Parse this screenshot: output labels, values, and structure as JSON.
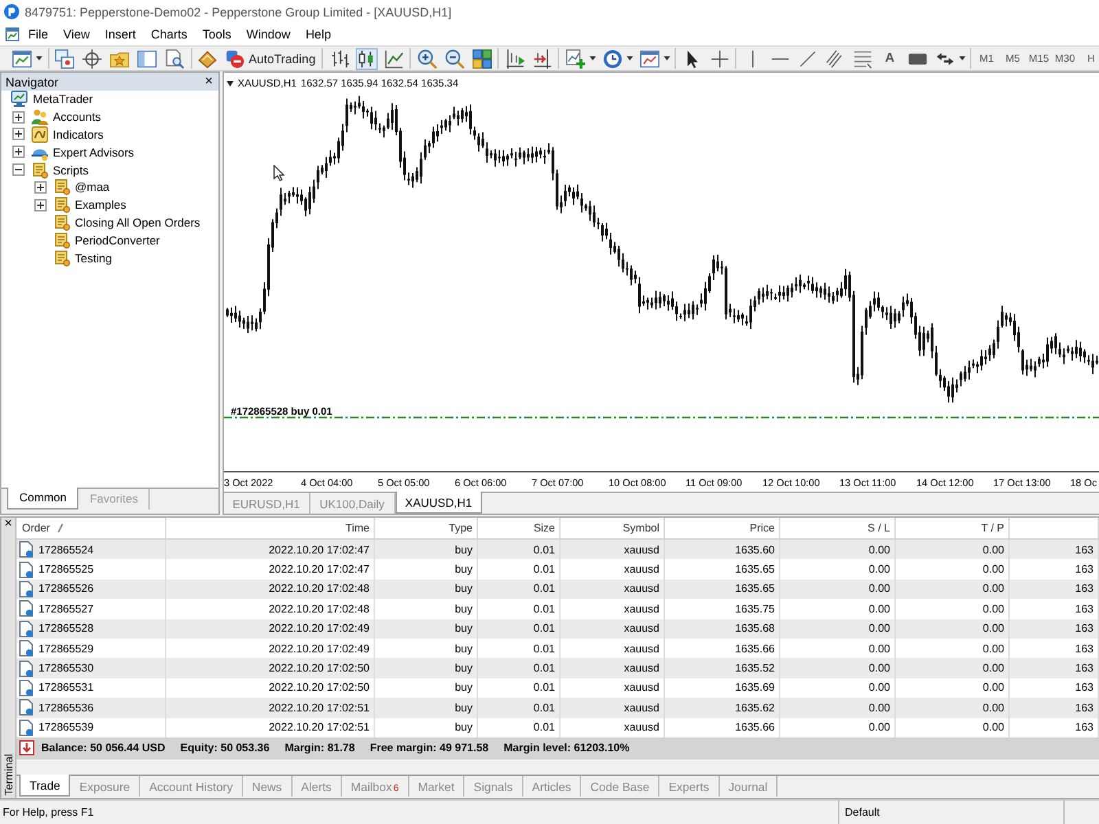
{
  "window": {
    "title": "8479751: Pepperstone-Demo02 - Pepperstone Group Limited - [XAUUSD,H1]"
  },
  "menu": [
    "File",
    "View",
    "Insert",
    "Charts",
    "Tools",
    "Window",
    "Help"
  ],
  "toolbar": {
    "autotrading": "AutoTrading",
    "chart_types": [
      {
        "selected": false
      },
      {
        "selected": true
      },
      {
        "selected": false
      }
    ],
    "text_tool": "A",
    "timeframes": [
      {
        "label": "M1",
        "selected": false
      },
      {
        "label": "M5",
        "selected": false
      },
      {
        "label": "M15",
        "selected": false
      },
      {
        "label": "M30",
        "selected": false
      },
      {
        "label": "H",
        "selected": false
      }
    ]
  },
  "navigator": {
    "title": "Navigator",
    "close": "×",
    "tree": [
      {
        "label": "MetaTrader",
        "kind": "root",
        "children": [
          {
            "label": "Accounts",
            "kind": "accounts",
            "expanded": false
          },
          {
            "label": "Indicators",
            "kind": "indicators",
            "expanded": false
          },
          {
            "label": "Expert Advisors",
            "kind": "experts",
            "expanded": false
          },
          {
            "label": "Scripts",
            "kind": "script",
            "expanded": true,
            "children": [
              {
                "label": "@maa",
                "kind": "script",
                "expanded": false
              },
              {
                "label": "Examples",
                "kind": "script",
                "expanded": false
              },
              {
                "label": "Closing All Open Orders",
                "kind": "script"
              },
              {
                "label": "PeriodConverter",
                "kind": "script"
              },
              {
                "label": "Testing",
                "kind": "script"
              }
            ]
          }
        ]
      }
    ],
    "tabs": [
      {
        "label": "Common",
        "selected": true
      },
      {
        "label": "Favorites",
        "selected": false
      }
    ]
  },
  "chart": {
    "symbol": "XAUUSD,H1",
    "quote": "1632.57 1635.94 1632.54 1635.34",
    "order_label": "#172865528 buy 0.01",
    "time_axis": [
      "3 Oct 2022",
      "4 Oct 04:00",
      "5 Oct 05:00",
      "6 Oct 06:00",
      "7 Oct 07:00",
      "10 Oct 08:00",
      "11 Oct 09:00",
      "12 Oct 10:00",
      "13 Oct 11:00",
      "14 Oct 12:00",
      "17 Oct 13:00",
      "18 Oc"
    ],
    "tabs": [
      {
        "label": "EURUSD,H1",
        "selected": false
      },
      {
        "label": "UK100,Daily",
        "selected": false
      },
      {
        "label": "XAUUSD,H1",
        "selected": true
      }
    ]
  },
  "terminal": {
    "close": "×",
    "title": "Terminal",
    "columns": [
      {
        "label": "Order",
        "sorted": true
      },
      {
        "label": "Time",
        "sorted": false
      },
      {
        "label": "Type",
        "sorted": false
      },
      {
        "label": "Size",
        "sorted": false
      },
      {
        "label": "Symbol",
        "sorted": false
      },
      {
        "label": "Price",
        "sorted": false
      },
      {
        "label": "S / L",
        "sorted": false
      },
      {
        "label": "T / P",
        "sorted": false
      }
    ],
    "rows": [
      [
        "172865524",
        "2022.10.20 17:02:47",
        "buy",
        "0.01",
        "xauusd",
        "1635.60",
        "0.00",
        "0.00",
        "163"
      ],
      [
        "172865525",
        "2022.10.20 17:02:47",
        "buy",
        "0.01",
        "xauusd",
        "1635.65",
        "0.00",
        "0.00",
        "163"
      ],
      [
        "172865526",
        "2022.10.20 17:02:48",
        "buy",
        "0.01",
        "xauusd",
        "1635.65",
        "0.00",
        "0.00",
        "163"
      ],
      [
        "172865527",
        "2022.10.20 17:02:48",
        "buy",
        "0.01",
        "xauusd",
        "1635.75",
        "0.00",
        "0.00",
        "163"
      ],
      [
        "172865528",
        "2022.10.20 17:02:49",
        "buy",
        "0.01",
        "xauusd",
        "1635.68",
        "0.00",
        "0.00",
        "163"
      ],
      [
        "172865529",
        "2022.10.20 17:02:49",
        "buy",
        "0.01",
        "xauusd",
        "1635.66",
        "0.00",
        "0.00",
        "163"
      ],
      [
        "172865530",
        "2022.10.20 17:02:50",
        "buy",
        "0.01",
        "xauusd",
        "1635.52",
        "0.00",
        "0.00",
        "163"
      ],
      [
        "172865531",
        "2022.10.20 17:02:50",
        "buy",
        "0.01",
        "xauusd",
        "1635.69",
        "0.00",
        "0.00",
        "163"
      ],
      [
        "172865536",
        "2022.10.20 17:02:51",
        "buy",
        "0.01",
        "xauusd",
        "1635.62",
        "0.00",
        "0.00",
        "163"
      ],
      [
        "172865539",
        "2022.10.20 17:02:51",
        "buy",
        "0.01",
        "xauusd",
        "1635.66",
        "0.00",
        "0.00",
        "163"
      ]
    ],
    "summary": [
      "Balance: 50 056.44 USD",
      "Equity: 50 053.36",
      "Margin: 81.78",
      "Free margin: 49 971.58",
      "Margin level: 61203.10%"
    ],
    "tabs": [
      {
        "label": "Trade",
        "selected": true
      },
      {
        "label": "Exposure",
        "selected": false
      },
      {
        "label": "Account History",
        "selected": false
      },
      {
        "label": "News",
        "selected": false
      },
      {
        "label": "Alerts",
        "selected": false
      },
      {
        "label": "Mailbox",
        "selected": false,
        "badge": "6"
      },
      {
        "label": "Market",
        "selected": false
      },
      {
        "label": "Signals",
        "selected": false
      },
      {
        "label": "Articles",
        "selected": false
      },
      {
        "label": "Code Base",
        "selected": false
      },
      {
        "label": "Experts",
        "selected": false
      },
      {
        "label": "Journal",
        "selected": false
      }
    ]
  },
  "status_bar": {
    "help": "For Help, press F1",
    "profile": "Default"
  }
}
